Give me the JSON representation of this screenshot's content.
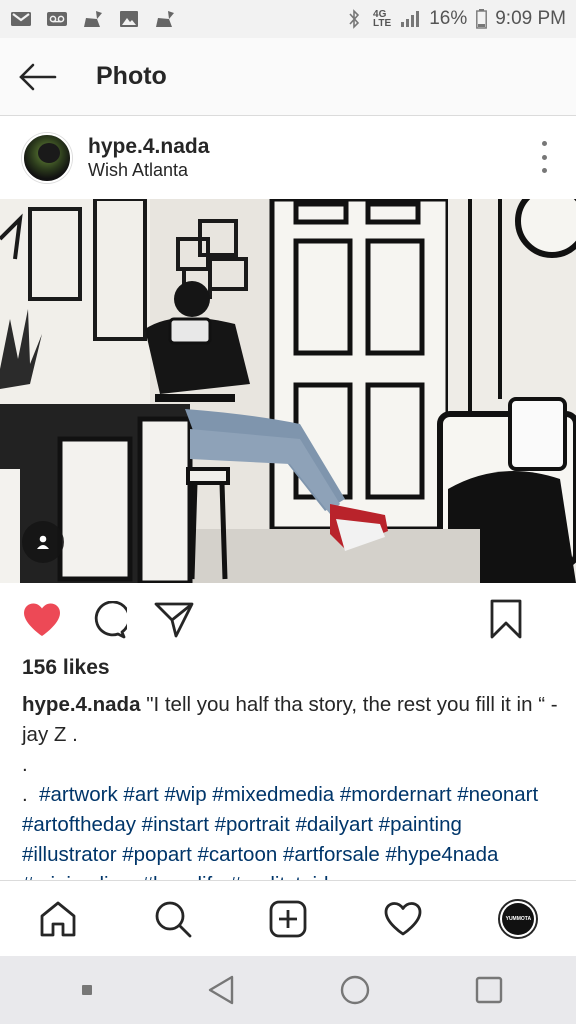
{
  "status_bar": {
    "battery": "16%",
    "time": "9:09 PM",
    "network": "4G\nLTE",
    "icons": [
      "gmail-icon",
      "voicemail-icon",
      "broom-icon",
      "image-icon",
      "broom-icon",
      "bluetooth-icon",
      "signal-icon",
      "battery-icon"
    ]
  },
  "header": {
    "title": "Photo"
  },
  "post": {
    "username": "hype.4.nada",
    "location": "Wish Atlanta",
    "likes": "156 likes",
    "caption_user": "hype.4.nada",
    "caption_text": " \"I tell you half tha story, the rest you fill it in “ - jay Z .",
    "caption_dots": [
      ".",
      "."
    ],
    "hashtags": "#artwork #art #wip #mixedmedia  #mordernart #neonart #artoftheday #instart #portrait #dailyart #painting #illustrator #popart #cartoon #artforsale #hype4nada #minimalism #hypelife #realitytoidea"
  },
  "bottom_nav": {
    "profile_text": "YUMMOTA"
  },
  "colors": {
    "like_red": "#ed4956",
    "hashtag_blue": "#003569",
    "text": "#262626"
  }
}
